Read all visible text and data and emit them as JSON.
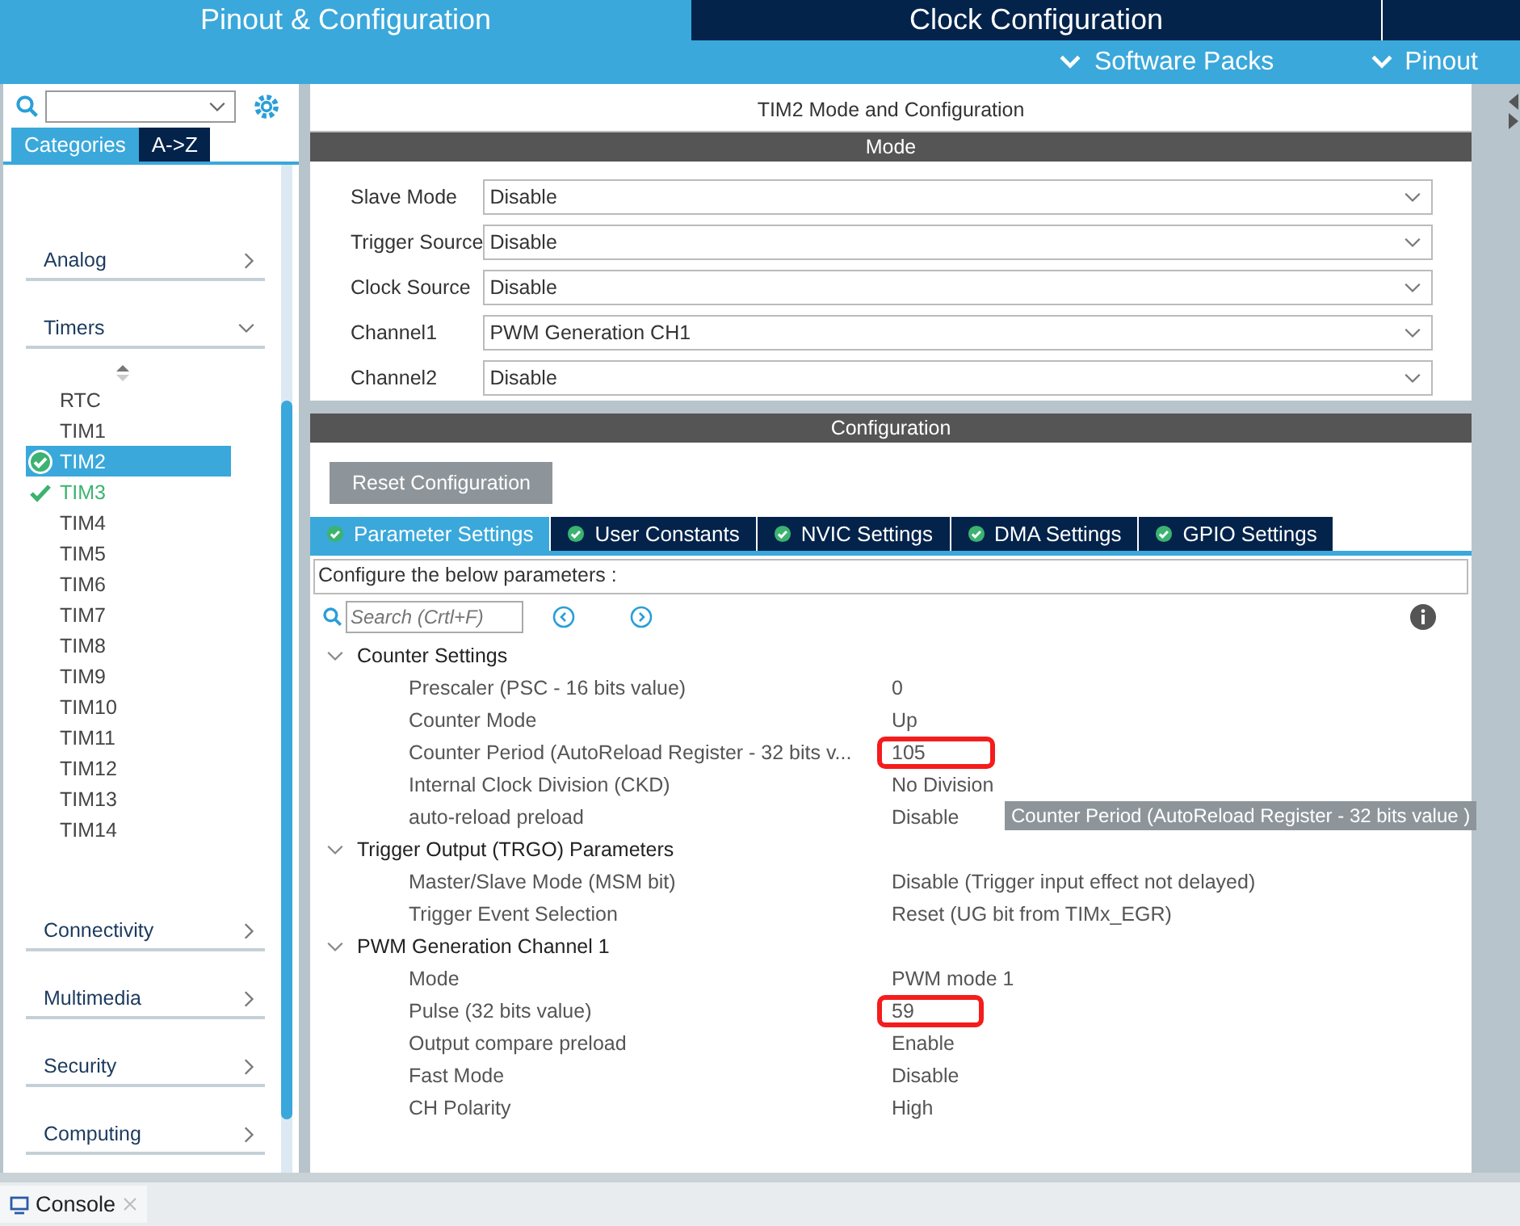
{
  "header": {
    "tabs": [
      {
        "label": "Pinout & Configuration",
        "selected": true
      },
      {
        "label": "Clock Configuration",
        "selected": false
      }
    ],
    "menus": [
      "Software Packs",
      "Pinout"
    ]
  },
  "sidebar": {
    "view_tabs": [
      {
        "label": "Categories",
        "selected": true
      },
      {
        "label": "A->Z",
        "selected": false
      }
    ],
    "categories": [
      {
        "label": "Analog",
        "expanded": false
      },
      {
        "label": "Timers",
        "expanded": true,
        "children": [
          {
            "label": "RTC",
            "configured": false,
            "selected": false
          },
          {
            "label": "TIM1",
            "configured": false,
            "selected": false
          },
          {
            "label": "TIM2",
            "configured": true,
            "selected": true
          },
          {
            "label": "TIM3",
            "configured": true,
            "selected": false
          },
          {
            "label": "TIM4",
            "configured": false,
            "selected": false
          },
          {
            "label": "TIM5",
            "configured": false,
            "selected": false
          },
          {
            "label": "TIM6",
            "configured": false,
            "selected": false
          },
          {
            "label": "TIM7",
            "configured": false,
            "selected": false
          },
          {
            "label": "TIM8",
            "configured": false,
            "selected": false
          },
          {
            "label": "TIM9",
            "configured": false,
            "selected": false
          },
          {
            "label": "TIM10",
            "configured": false,
            "selected": false
          },
          {
            "label": "TIM11",
            "configured": false,
            "selected": false
          },
          {
            "label": "TIM12",
            "configured": false,
            "selected": false
          },
          {
            "label": "TIM13",
            "configured": false,
            "selected": false
          },
          {
            "label": "TIM14",
            "configured": false,
            "selected": false
          }
        ]
      },
      {
        "label": "Connectivity",
        "expanded": false
      },
      {
        "label": "Multimedia",
        "expanded": false
      },
      {
        "label": "Security",
        "expanded": false
      },
      {
        "label": "Computing",
        "expanded": false
      }
    ]
  },
  "main": {
    "title": "TIM2 Mode and Configuration",
    "mode_header": "Mode",
    "mode_fields": [
      {
        "label": "Slave Mode",
        "value": "Disable"
      },
      {
        "label": "Trigger Source",
        "value": "Disable"
      },
      {
        "label": "Clock Source",
        "value": "Disable"
      },
      {
        "label": "Channel1",
        "value": "PWM Generation CH1"
      },
      {
        "label": "Channel2",
        "value": "Disable"
      }
    ],
    "config_header": "Configuration",
    "reset_button": "Reset Configuration",
    "config_tabs": [
      {
        "label": "Parameter Settings",
        "selected": true
      },
      {
        "label": "User Constants",
        "selected": false
      },
      {
        "label": "NVIC Settings",
        "selected": false
      },
      {
        "label": "DMA Settings",
        "selected": false
      },
      {
        "label": "GPIO Settings",
        "selected": false
      }
    ],
    "hint": "Configure the below parameters :",
    "search": {
      "placeholder": "Search (Crtl+F)"
    },
    "groups": [
      {
        "title": "Counter Settings",
        "expanded": true,
        "params": [
          {
            "name": "Prescaler (PSC - 16 bits value)",
            "value": "0",
            "highlighted": false
          },
          {
            "name": "Counter Mode",
            "value": "Up",
            "highlighted": false
          },
          {
            "name": "Counter Period (AutoReload Register - 32 bits v...",
            "value": "105",
            "highlighted": true,
            "tooltip": "Counter Period (AutoReload Register - 32 bits value )"
          },
          {
            "name": "Internal Clock Division (CKD)",
            "value": "No Division",
            "highlighted": false
          },
          {
            "name": "auto-reload preload",
            "value": "Disable",
            "highlighted": false
          }
        ]
      },
      {
        "title": "Trigger Output (TRGO) Parameters",
        "expanded": true,
        "params": [
          {
            "name": "Master/Slave Mode (MSM bit)",
            "value": "Disable (Trigger input effect not delayed)",
            "highlighted": false
          },
          {
            "name": "Trigger Event Selection",
            "value": "Reset (UG bit from TIMx_EGR)",
            "highlighted": false
          }
        ]
      },
      {
        "title": "PWM Generation Channel 1",
        "expanded": true,
        "params": [
          {
            "name": "Mode",
            "value": "PWM mode 1",
            "highlighted": false
          },
          {
            "name": "Pulse (32 bits value)",
            "value": "59",
            "highlighted": true
          },
          {
            "name": "Output compare preload",
            "value": "Enable",
            "highlighted": false
          },
          {
            "name": "Fast Mode",
            "value": "Disable",
            "highlighted": false
          },
          {
            "name": "CH Polarity",
            "value": "High",
            "highlighted": false
          }
        ]
      }
    ]
  },
  "console": {
    "tab": "Console"
  }
}
